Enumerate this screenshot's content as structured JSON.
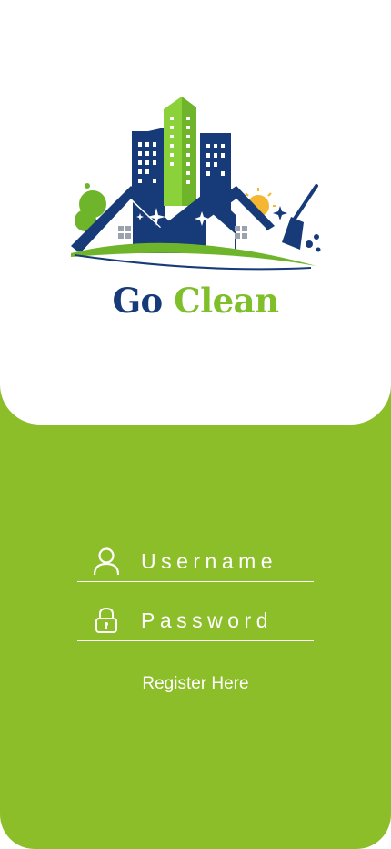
{
  "brand": {
    "word1": "Go",
    "word2": "Clean",
    "word1_color": "#173a78",
    "word2_color": "#7fbf2a"
  },
  "colors": {
    "background_green": "#8cbe2a",
    "panel": "#ffffff",
    "navy": "#173a78",
    "lime": "#7fbf2a"
  },
  "login": {
    "username_placeholder": "Username",
    "username_icon": "user-icon",
    "password_placeholder": "Password",
    "password_icon": "lock-icon",
    "register_label": "Register Here"
  }
}
